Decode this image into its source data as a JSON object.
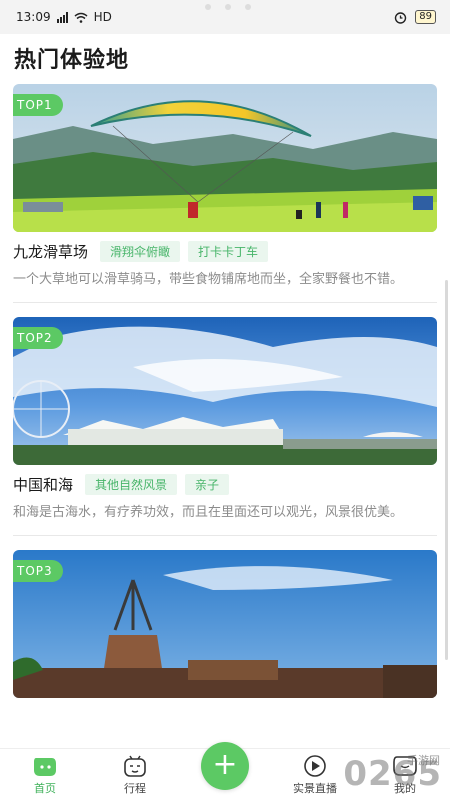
{
  "status_bar": {
    "time": "13:09",
    "network": "HD",
    "battery": "89"
  },
  "header": {
    "title": "热门体验地"
  },
  "cards": [
    {
      "badge": "TOP1",
      "name": "九龙滑草场",
      "tags": [
        "滑翔伞俯瞰",
        "打卡卡丁车"
      ],
      "desc": "一个大草地可以滑草骑马，带些食物铺席地而坐，全家野餐也不错。"
    },
    {
      "badge": "TOP2",
      "name": "中国和海",
      "tags": [
        "其他自然风景",
        "亲子"
      ],
      "desc": "和海是古海水，有疗养功效，而且在里面还可以观光，风景很优美。"
    },
    {
      "badge": "TOP3",
      "name": "",
      "tags": [],
      "desc": ""
    }
  ],
  "bottom_nav": {
    "home": "首页",
    "trip": "行程",
    "add": "+",
    "live": "实景直播",
    "mine": "我的"
  },
  "watermark": {
    "main": "0265",
    "sub": "手游网"
  },
  "colors": {
    "accent": "#5cc964",
    "tag_text": "#48b56a",
    "tag_bg": "#eaf6ee"
  }
}
